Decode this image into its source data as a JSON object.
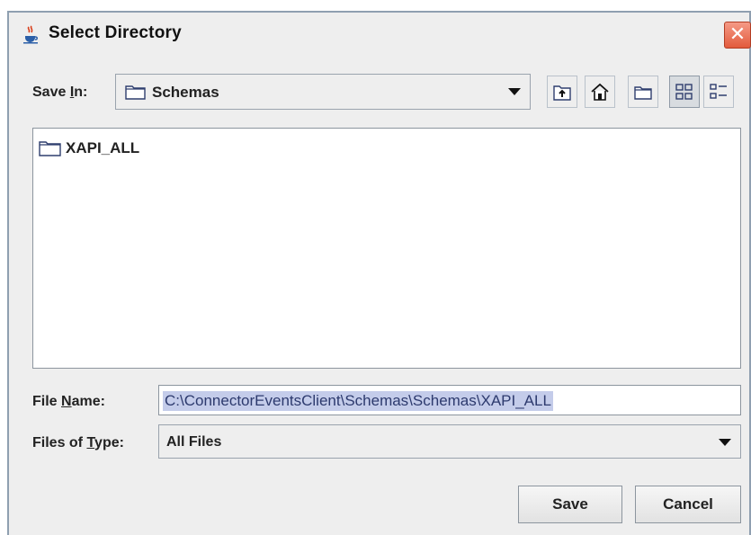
{
  "window": {
    "title": "Select Directory",
    "close_glyph": "✕"
  },
  "save_in": {
    "label_prefix": "Save ",
    "label_mnemonic": "I",
    "label_suffix": "n:",
    "value": "Schemas"
  },
  "toolbar": {
    "buttons": [
      {
        "name": "up-one-level-icon"
      },
      {
        "name": "home-icon"
      },
      {
        "name": "new-folder-icon"
      },
      {
        "name": "list-view-icon",
        "active": true
      },
      {
        "name": "details-view-icon"
      }
    ]
  },
  "file_list": {
    "items": [
      {
        "label": "XAPI_ALL",
        "icon": "folder-icon"
      }
    ]
  },
  "file_name": {
    "label_prefix": "File ",
    "label_mnemonic": "N",
    "label_suffix": "ame:",
    "value": "C:\\ConnectorEventsClient\\Schemas\\Schemas\\XAPI_ALL"
  },
  "files_of_type": {
    "label_prefix": "Files of ",
    "label_mnemonic": "T",
    "label_suffix": "ype:",
    "value": "All Files"
  },
  "buttons": {
    "save": "Save",
    "cancel": "Cancel"
  },
  "colors": {
    "selection_bg": "#c4ccea",
    "close_red": "#e25b3d"
  }
}
